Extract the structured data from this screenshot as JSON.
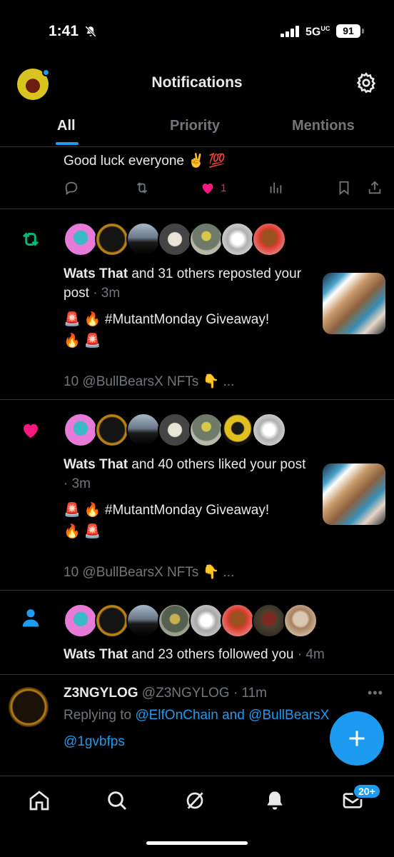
{
  "status_bar": {
    "time": "1:41",
    "network": "5G",
    "network_sup": "UC",
    "battery": "91"
  },
  "header": {
    "title": "Notifications"
  },
  "tabs": [
    {
      "label": "All",
      "active": true
    },
    {
      "label": "Priority",
      "active": false
    },
    {
      "label": "Mentions",
      "active": false
    }
  ],
  "partial_post": {
    "text": "Good luck everyone ✌️ 💯",
    "like_count": "1"
  },
  "notifications": [
    {
      "type": "repost",
      "actor": "Wats That",
      "rest": " and 31 others reposted your post",
      "time": " · 3m",
      "line1": "🚨 🔥 #MutantMonday Giveaway!",
      "line2": "🔥 🚨",
      "footer": "10 @BullBearsX NFTs 👇 ..."
    },
    {
      "type": "like",
      "actor": "Wats That",
      "rest": " and 40 others liked your post",
      "time": " · 3m",
      "line1": "🚨 🔥 #MutantMonday Giveaway!",
      "line2": "🔥 🚨",
      "footer": "10 @BullBearsX NFTs 👇 ..."
    },
    {
      "type": "follow",
      "actor": "Wats That",
      "rest": " and 23 others followed you",
      "time": " · 4m"
    }
  ],
  "reply_post": {
    "name": "Z3NGYLOG",
    "handle": "@Z3NGYLOG",
    "time": "· 11m",
    "replying_prefix": "Replying to ",
    "replying_to": "@ElfOnChain and @BullBearsX",
    "mention": "@1gvbfps"
  },
  "bottom_nav": {
    "messages_badge": "20+"
  },
  "colors": {
    "accent": "#1d9bf0",
    "like": "#f91880",
    "repost": "#00ba7c",
    "muted": "#71767b"
  }
}
